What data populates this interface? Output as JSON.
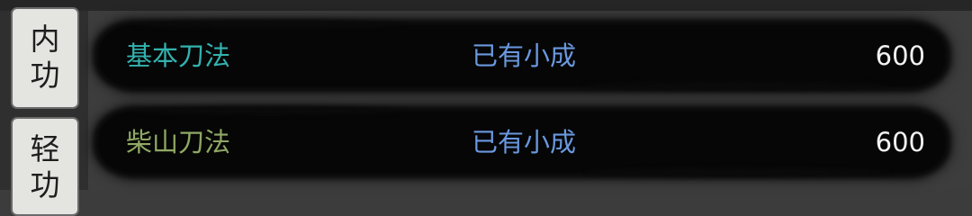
{
  "side_tabs": [
    {
      "label": "内\n功"
    },
    {
      "label": "轻\n功"
    }
  ],
  "skills": [
    {
      "name": "基本刀法",
      "status": "已有小成",
      "value": "600",
      "name_color": "#33b2ae"
    },
    {
      "name": "柴山刀法",
      "status": "已有小成",
      "value": "600",
      "name_color": "#8fa864"
    }
  ],
  "colors": {
    "status": "#6a98de",
    "value": "#f2f2f2",
    "row_background": "#060606",
    "tab_background": "#e4e4e0"
  }
}
